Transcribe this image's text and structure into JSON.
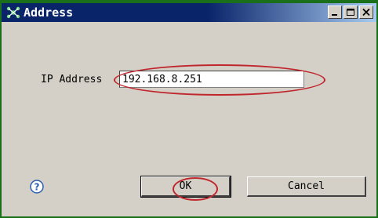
{
  "window": {
    "title": "Address",
    "title_icon": "network-icon",
    "controls": [
      "minimize-icon",
      "maximize-icon",
      "close-icon"
    ]
  },
  "form": {
    "ip_label": "IP Address",
    "ip_value": "192.168.8.251"
  },
  "buttons": {
    "help_icon": "help-icon",
    "ok_label": "OK",
    "cancel_label": "Cancel"
  },
  "colors": {
    "titlebar": "#0a246a",
    "frame": "#1a6f1a",
    "dialog_bg": "#d4d0c8",
    "annotation": "#c0272d"
  }
}
